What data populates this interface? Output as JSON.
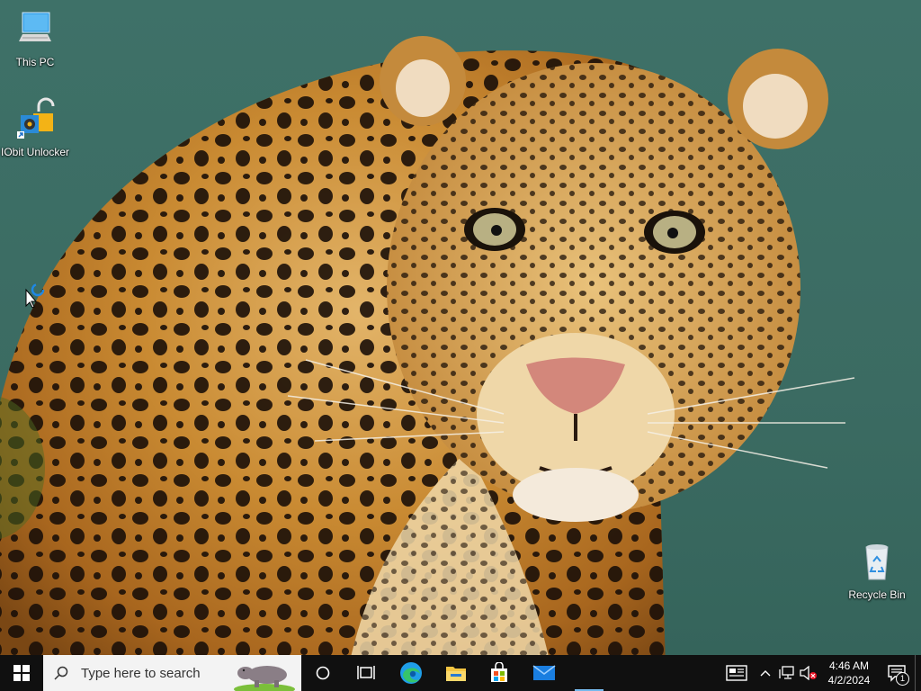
{
  "desktop": {
    "icons": [
      {
        "label": "This PC"
      },
      {
        "label": "IObit Unlocker"
      },
      {
        "label": "Recycle Bin"
      }
    ]
  },
  "taskbar": {
    "search_placeholder": "Type here to search",
    "pinned": [
      {
        "icon": "cortana-icon"
      },
      {
        "icon": "task-view-icon"
      },
      {
        "icon": "edge-icon"
      },
      {
        "icon": "file-explorer-icon"
      },
      {
        "icon": "microsoft-store-icon"
      },
      {
        "icon": "mail-icon"
      }
    ],
    "clock": {
      "time": "4:46 AM",
      "date": "4/2/2024"
    },
    "notification_count": "1"
  },
  "colors": {
    "taskbar": "#101010",
    "wallpaper_bg": "#3d6f66",
    "accent": "#0078d7"
  }
}
